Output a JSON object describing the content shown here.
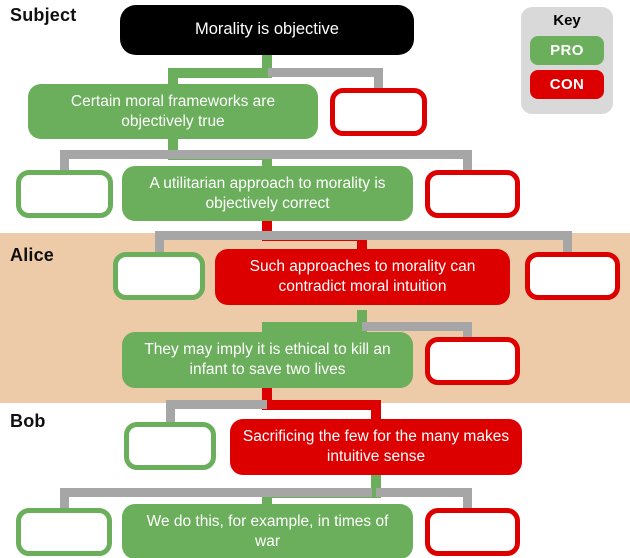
{
  "diagram": {
    "type": "argument-tree",
    "colors": {
      "pro": "#6baf5c",
      "con": "#dd0000",
      "neutral_connector": "#a6a6a6",
      "root": "#000000",
      "alice_band": "#edcba8",
      "key_background": "#d9d9d9"
    }
  },
  "bands": [
    {
      "id": "subject",
      "label": "Subject"
    },
    {
      "id": "alice",
      "label": "Alice"
    },
    {
      "id": "bob",
      "label": "Bob"
    }
  ],
  "key": {
    "title": "Key",
    "entries": [
      {
        "label": "PRO",
        "color": "#6baf5c"
      },
      {
        "label": "CON",
        "color": "#dd0000"
      }
    ]
  },
  "nodes": {
    "root": {
      "text": "Morality is objective",
      "stance": "root",
      "filled": true
    },
    "r1_main": {
      "text": "Certain moral frameworks are objectively true",
      "stance": "pro",
      "filled": true
    },
    "r1_con": {
      "text": "",
      "stance": "con",
      "filled": false
    },
    "r2_pro": {
      "text": "",
      "stance": "pro",
      "filled": false
    },
    "r2_main": {
      "text": "A utilitarian approach to morality is objectively correct",
      "stance": "pro",
      "filled": true
    },
    "r2_con": {
      "text": "",
      "stance": "con",
      "filled": false
    },
    "r3_pro": {
      "text": "",
      "stance": "pro",
      "filled": false
    },
    "r3_main": {
      "text": "Such approaches to morality can contradict moral intuition",
      "stance": "con",
      "filled": true
    },
    "r3_con": {
      "text": "",
      "stance": "con",
      "filled": false
    },
    "r4_main": {
      "text": "They may imply it is ethical to kill an infant to save two lives",
      "stance": "pro",
      "filled": true
    },
    "r4_con": {
      "text": "",
      "stance": "con",
      "filled": false
    },
    "r5_pro": {
      "text": "",
      "stance": "pro",
      "filled": false
    },
    "r5_main": {
      "text": "Sacrificing the few for the many makes intuitive sense",
      "stance": "con",
      "filled": true
    },
    "r6_pro": {
      "text": "",
      "stance": "pro",
      "filled": false
    },
    "r6_main": {
      "text": "We do this, for example, in times of war",
      "stance": "pro",
      "filled": true
    },
    "r6_con": {
      "text": "",
      "stance": "con",
      "filled": false
    }
  }
}
